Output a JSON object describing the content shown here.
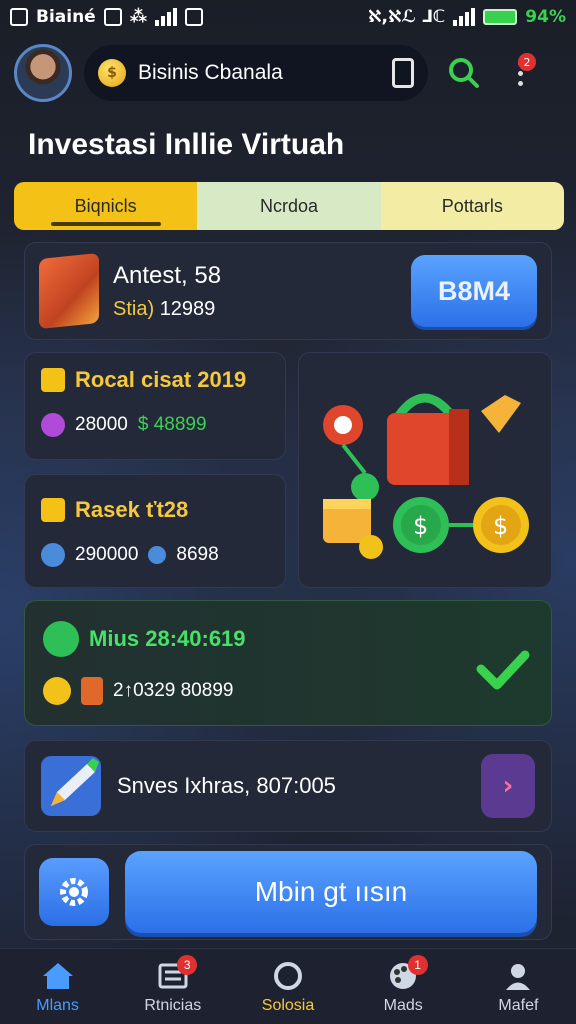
{
  "status_bar": {
    "app_label": "Biainé",
    "icons_left": [
      "notification-icon",
      "clipboard-icon",
      "grid-icon",
      "signal-icon",
      "image-icon"
    ],
    "right_text": "ℵ,ℵℒ ⅃ℂ",
    "battery": "94%"
  },
  "header": {
    "app_name": "Bisinis Cbanala",
    "badge_count": "2"
  },
  "page": {
    "title": "Investasi Inllie Virtuah"
  },
  "tabs": [
    {
      "label": "Biqnicls"
    },
    {
      "label": "Ncrdoa"
    },
    {
      "label": "Pottarls"
    }
  ],
  "cards": {
    "featured": {
      "title": "Antest, 58",
      "sub_prefix": "Stia)",
      "sub_value": "12989",
      "button": "B8M4"
    },
    "left_top": {
      "title": "Rocal cisat 2019",
      "values": "28000",
      "green_value": "$ 48899"
    },
    "left_bottom": {
      "title": "Rasek ťt28",
      "values": "290000",
      "extra": "8698"
    },
    "status": {
      "title": "Mius 28:40:619",
      "sub": "2↑0329 80899"
    },
    "promo": {
      "text": "Snves Ixhras, 807:005",
      "arrow": "›"
    }
  },
  "action_bar": {
    "main_button": "Mbin gt ıısın"
  },
  "bottom_nav": [
    {
      "label": "Mlans",
      "icon": "home-icon"
    },
    {
      "label": "Rtnicias",
      "icon": "news-icon",
      "badge": "3"
    },
    {
      "label": "Solosia",
      "icon": "circle-icon"
    },
    {
      "label": "Mads",
      "icon": "palette-icon",
      "badge": "1"
    },
    {
      "label": "Mafef",
      "icon": "profile-icon"
    }
  ],
  "colors": {
    "accent_blue": "#2c70e8",
    "accent_yellow": "#f4c117",
    "accent_green": "#3ad14f",
    "background": "#1b1f2a"
  }
}
